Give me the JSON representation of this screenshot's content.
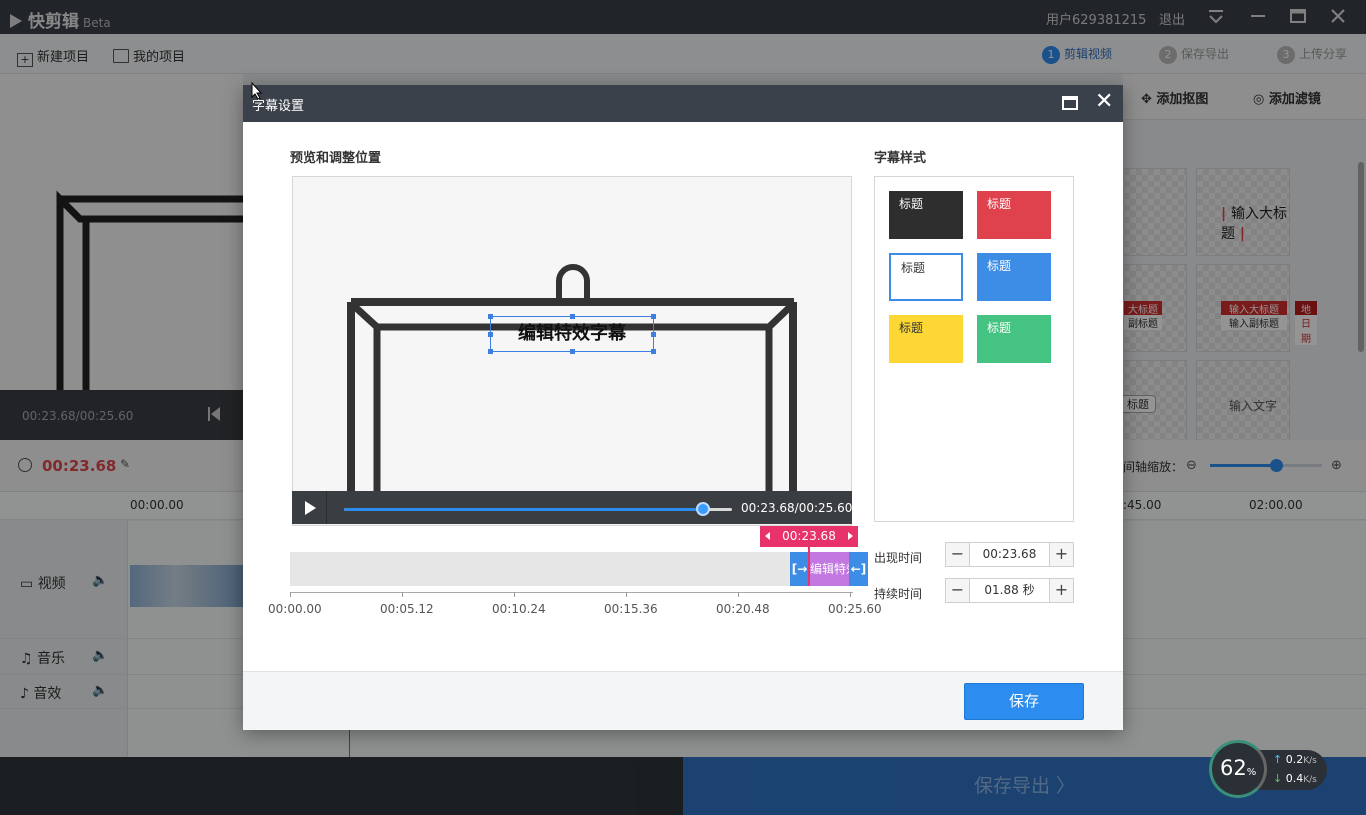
{
  "app": {
    "name": "快剪辑",
    "badge": "Beta",
    "user": "用户629381215",
    "logout": "退出"
  },
  "toolbar": {
    "new_project": "新建项目",
    "my_projects": "我的项目",
    "steps": [
      {
        "num": "1",
        "label": "剪辑视频"
      },
      {
        "num": "2",
        "label": "保存导出"
      },
      {
        "num": "3",
        "label": "上传分享"
      }
    ]
  },
  "preview_left": {
    "time": "00:23.68/00:25.60"
  },
  "right_tabs": {
    "add_matting": "添加抠图",
    "add_filter": "添加滤镜"
  },
  "templates": {
    "big_title": "输入大标题",
    "big_title2": "输入大标题",
    "sub_title": "输入副标题",
    "place": "地点",
    "date": "日期",
    "big_title_cut": "大标题",
    "sub_title_cut": "副标题",
    "title_cut": "标题",
    "input_text": "输入文字"
  },
  "timeline": {
    "current": "00:23.68",
    "zoom_label": "间轴缩放：",
    "ruler": [
      "00:00.00",
      ":45.00",
      "02:00.00"
    ],
    "tracks": [
      {
        "label": "视频"
      },
      {
        "label": "音乐"
      },
      {
        "label": "音效"
      }
    ]
  },
  "bottom": {
    "export": "保存导出 〉",
    "cpu_percent": "62",
    "percent_sign": "%",
    "up": "0.2",
    "down": "0.4",
    "speed_unit": "K/s"
  },
  "dialog": {
    "title": "字幕设置",
    "preview_section": "预览和调整位置",
    "style_section": "字幕样式",
    "subtitle_text": "编辑特效字幕",
    "player_time": "00:23.68/00:25.60",
    "player_progress": 0.925,
    "marker_time": "00:23.68",
    "clip_label": "编辑特效字幕",
    "clip_left_handle": "[→",
    "clip_right_handle": "←]",
    "ruler_labels": [
      "00:00.00",
      "00:05.12",
      "00:10.24",
      "00:15.36",
      "00:20.48",
      "00:25.60"
    ],
    "styles": [
      {
        "label": "标题",
        "bg": "#2e2e2e",
        "fg": "#ffffff",
        "outline": false
      },
      {
        "label": "标题",
        "bg": "#e0424d",
        "fg": "#ffffff",
        "outline": false
      },
      {
        "label": "标题",
        "bg": "#ffffff",
        "fg": "#333333",
        "outline": true
      },
      {
        "label": "标题",
        "bg": "#3d8de6",
        "fg": "#ffffff",
        "outline": false
      },
      {
        "label": "标题",
        "bg": "#fdd835",
        "fg": "#333333",
        "outline": false
      },
      {
        "label": "标题",
        "bg": "#45c382",
        "fg": "#ffffff",
        "outline": false
      }
    ],
    "appear_label": "出现时间",
    "appear_value": "00:23.68",
    "duration_label": "持续时间",
    "duration_value": "01.88 秒",
    "save": "保存"
  },
  "colors": {
    "accent": "#2d8cf0",
    "marker": "#e8336a",
    "clip": "#c377e0",
    "time_red": "#e0474c"
  }
}
